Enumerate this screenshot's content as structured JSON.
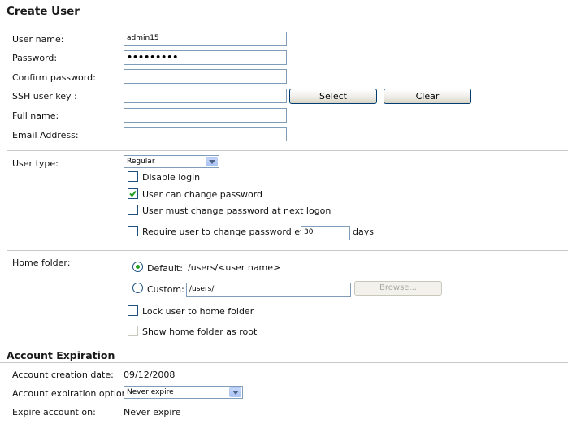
{
  "create_user": {
    "title": "Create User",
    "fields": {
      "user_name": {
        "label": "User name:",
        "value": "admin15"
      },
      "password": {
        "label": "Password:",
        "value": "•••••••••"
      },
      "confirm_password": {
        "label": "Confirm password:",
        "value": ""
      },
      "ssh_user_key": {
        "label": "SSH user key :",
        "value": "",
        "select_label": "Select",
        "clear_label": "Clear"
      },
      "full_name": {
        "label": "Full name:",
        "value": ""
      },
      "email_address": {
        "label": "Email Address:",
        "value": ""
      }
    },
    "user_type": {
      "label": "User type:",
      "selected": "Regular",
      "disable_login": {
        "label": "Disable login",
        "checked": false
      },
      "can_change_password": {
        "label": "User can change password",
        "checked": true
      },
      "must_change_password": {
        "label": "User must change password at next logon",
        "checked": false
      },
      "require_change": {
        "label": "Require user to change password every",
        "days_value": "30",
        "days_label": "days",
        "checked": false
      }
    },
    "home_folder": {
      "label": "Home folder:",
      "default_label": "Default:",
      "default_path": "/users/<user name>",
      "custom_label": "Custom:",
      "custom_value": "/users/",
      "browse_label": "Browse...",
      "selected": "default",
      "lock_label": "Lock user to home folder",
      "show_root_label": "Show home folder as root"
    }
  },
  "account_expiration": {
    "title": "Account Expiration",
    "creation_date_label": "Account creation date:",
    "creation_date": "09/12/2008",
    "option_label": "Account expiration option:",
    "option_selected": "Never expire",
    "expire_on_label": "Expire account on:",
    "expire_on_value": "Never expire"
  },
  "colors": {
    "accent_check": "#21a121",
    "input_border": "#7f9db9",
    "rule": "#c9c9c9"
  }
}
